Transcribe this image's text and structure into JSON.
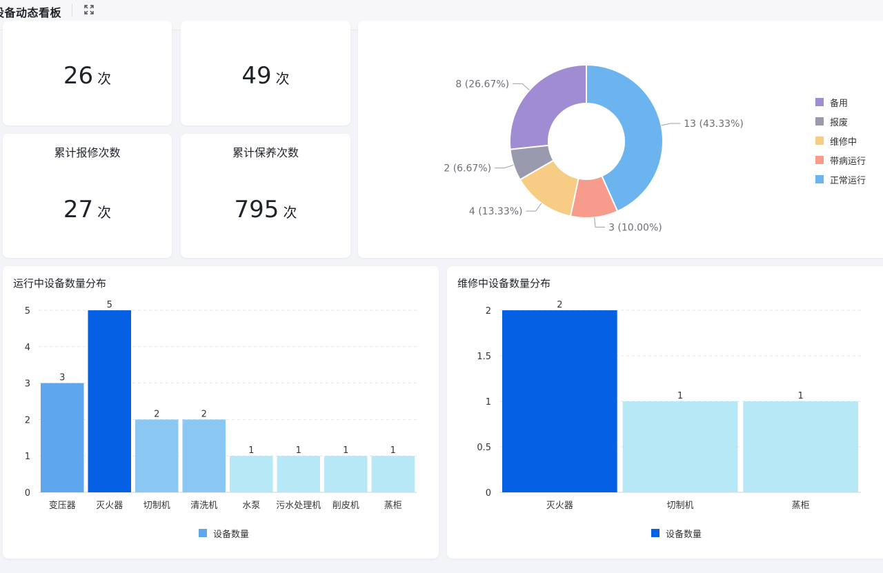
{
  "header": {
    "title": "设备动态看板",
    "expand_icon": "expand-icon"
  },
  "stats": [
    {
      "label": "",
      "value": "26",
      "unit": "次"
    },
    {
      "label": "",
      "value": "49",
      "unit": "次"
    },
    {
      "label": "累计报修次数",
      "value": "27",
      "unit": "次"
    },
    {
      "label": "累计保养次数",
      "value": "795",
      "unit": "次"
    }
  ],
  "chart_data": [
    {
      "type": "pie",
      "variant": "donut",
      "legend_position": "right",
      "slices": [
        {
          "name": "正常运行",
          "value": 13,
          "label": "13 (43.33%)",
          "color": "#6cb4ef"
        },
        {
          "name": "带病运行",
          "value": 3,
          "label": "3 (10.00%)",
          "color": "#f79c8c"
        },
        {
          "name": "维修中",
          "value": 4,
          "label": "4 (13.33%)",
          "color": "#f7cd85"
        },
        {
          "name": "报废",
          "value": 2,
          "label": "2 (6.67%)",
          "color": "#9a9aae"
        },
        {
          "name": "备用",
          "value": 8,
          "label": "8 (26.67%)",
          "color": "#9f8cd3"
        }
      ],
      "legend_order": [
        "备用",
        "报废",
        "维修中",
        "带病运行",
        "正常运行"
      ]
    },
    {
      "type": "bar",
      "title": "运行中设备数量分布",
      "categories": [
        "变压器",
        "灭火器",
        "切制机",
        "清洗机",
        "水泵",
        "污水处理机",
        "削皮机",
        "蒸柜"
      ],
      "values": [
        3,
        5,
        2,
        2,
        1,
        1,
        1,
        1
      ],
      "colors": [
        "#5fa7ec",
        "#0560e3",
        "#8ac7f2",
        "#8ac7f2",
        "#b7e8f5",
        "#b7e8f5",
        "#b7e8f5",
        "#b7e8f5"
      ],
      "ylim": [
        0,
        5
      ],
      "yticks": [
        "0",
        "1",
        "2",
        "3",
        "4",
        "5"
      ],
      "grid": true,
      "legend": {
        "label": "设备数量",
        "color": "#5fa7ec"
      }
    },
    {
      "type": "bar",
      "title": "维修中设备数量分布",
      "categories": [
        "灭火器",
        "切制机",
        "蒸柜"
      ],
      "values": [
        2,
        1,
        1
      ],
      "colors": [
        "#0560e3",
        "#b7e8f5",
        "#b7e8f5"
      ],
      "ylim": [
        0,
        2
      ],
      "yticks": [
        "0",
        "0.5",
        "1",
        "1.5",
        "2"
      ],
      "grid": true,
      "legend": {
        "label": "设备数量",
        "color": "#0560e3"
      }
    }
  ]
}
